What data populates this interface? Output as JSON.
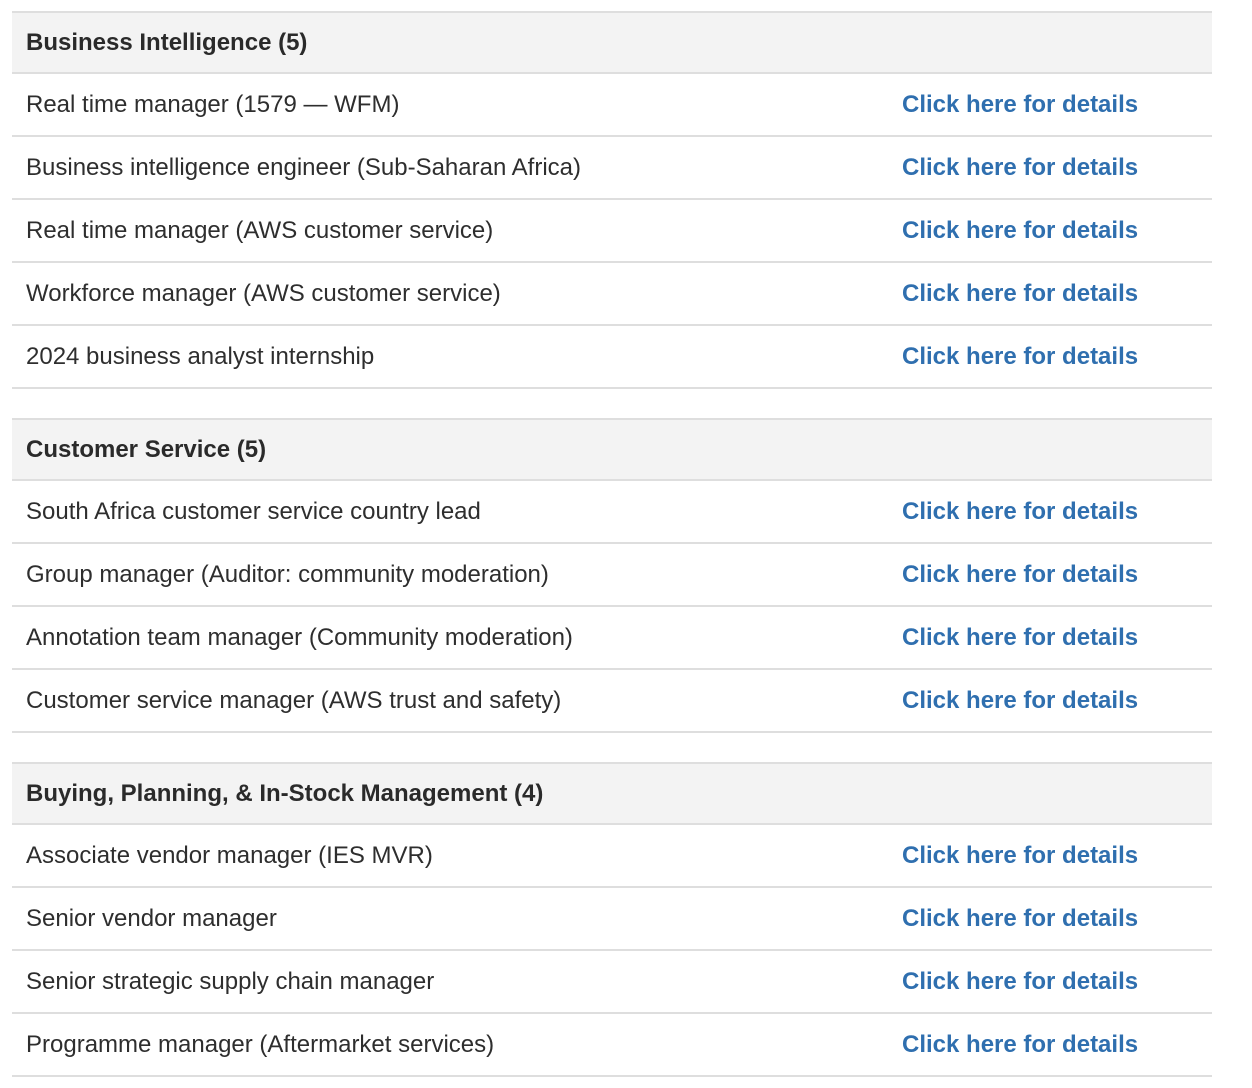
{
  "groups": [
    {
      "header": "Business Intelligence (5)",
      "rows": [
        {
          "title": "Real time manager (1579 — WFM)",
          "link": "Click here for details"
        },
        {
          "title": "Business intelligence engineer (Sub-Saharan Africa)",
          "link": "Click here for details"
        },
        {
          "title": "Real time manager (AWS customer service)",
          "link": "Click here for details"
        },
        {
          "title": "Workforce manager (AWS customer service)",
          "link": "Click here for details"
        },
        {
          "title": "2024 business analyst internship",
          "link": "Click here for details"
        }
      ]
    },
    {
      "header": "Customer Service (5)",
      "rows": [
        {
          "title": "South Africa customer service country lead",
          "link": "Click here for details"
        },
        {
          "title": "Group manager (Auditor: community moderation)",
          "link": "Click here for details"
        },
        {
          "title": "Annotation team manager (Community moderation)",
          "link": "Click here for details"
        },
        {
          "title": "Customer service manager (AWS trust and safety)",
          "link": "Click here for details"
        }
      ]
    },
    {
      "header": "Buying, Planning, & In-Stock Management (4)",
      "rows": [
        {
          "title": "Associate vendor manager (IES MVR)",
          "link": "Click here for details"
        },
        {
          "title": "Senior vendor manager",
          "link": "Click here for details"
        },
        {
          "title": "Senior strategic supply chain manager",
          "link": "Click here for details"
        },
        {
          "title": "Programme manager (Aftermarket services)",
          "link": "Click here for details"
        }
      ]
    }
  ],
  "colors": {
    "link": "#2f6faf",
    "header_bg": "#f3f3f3",
    "divider": "#dedede"
  }
}
